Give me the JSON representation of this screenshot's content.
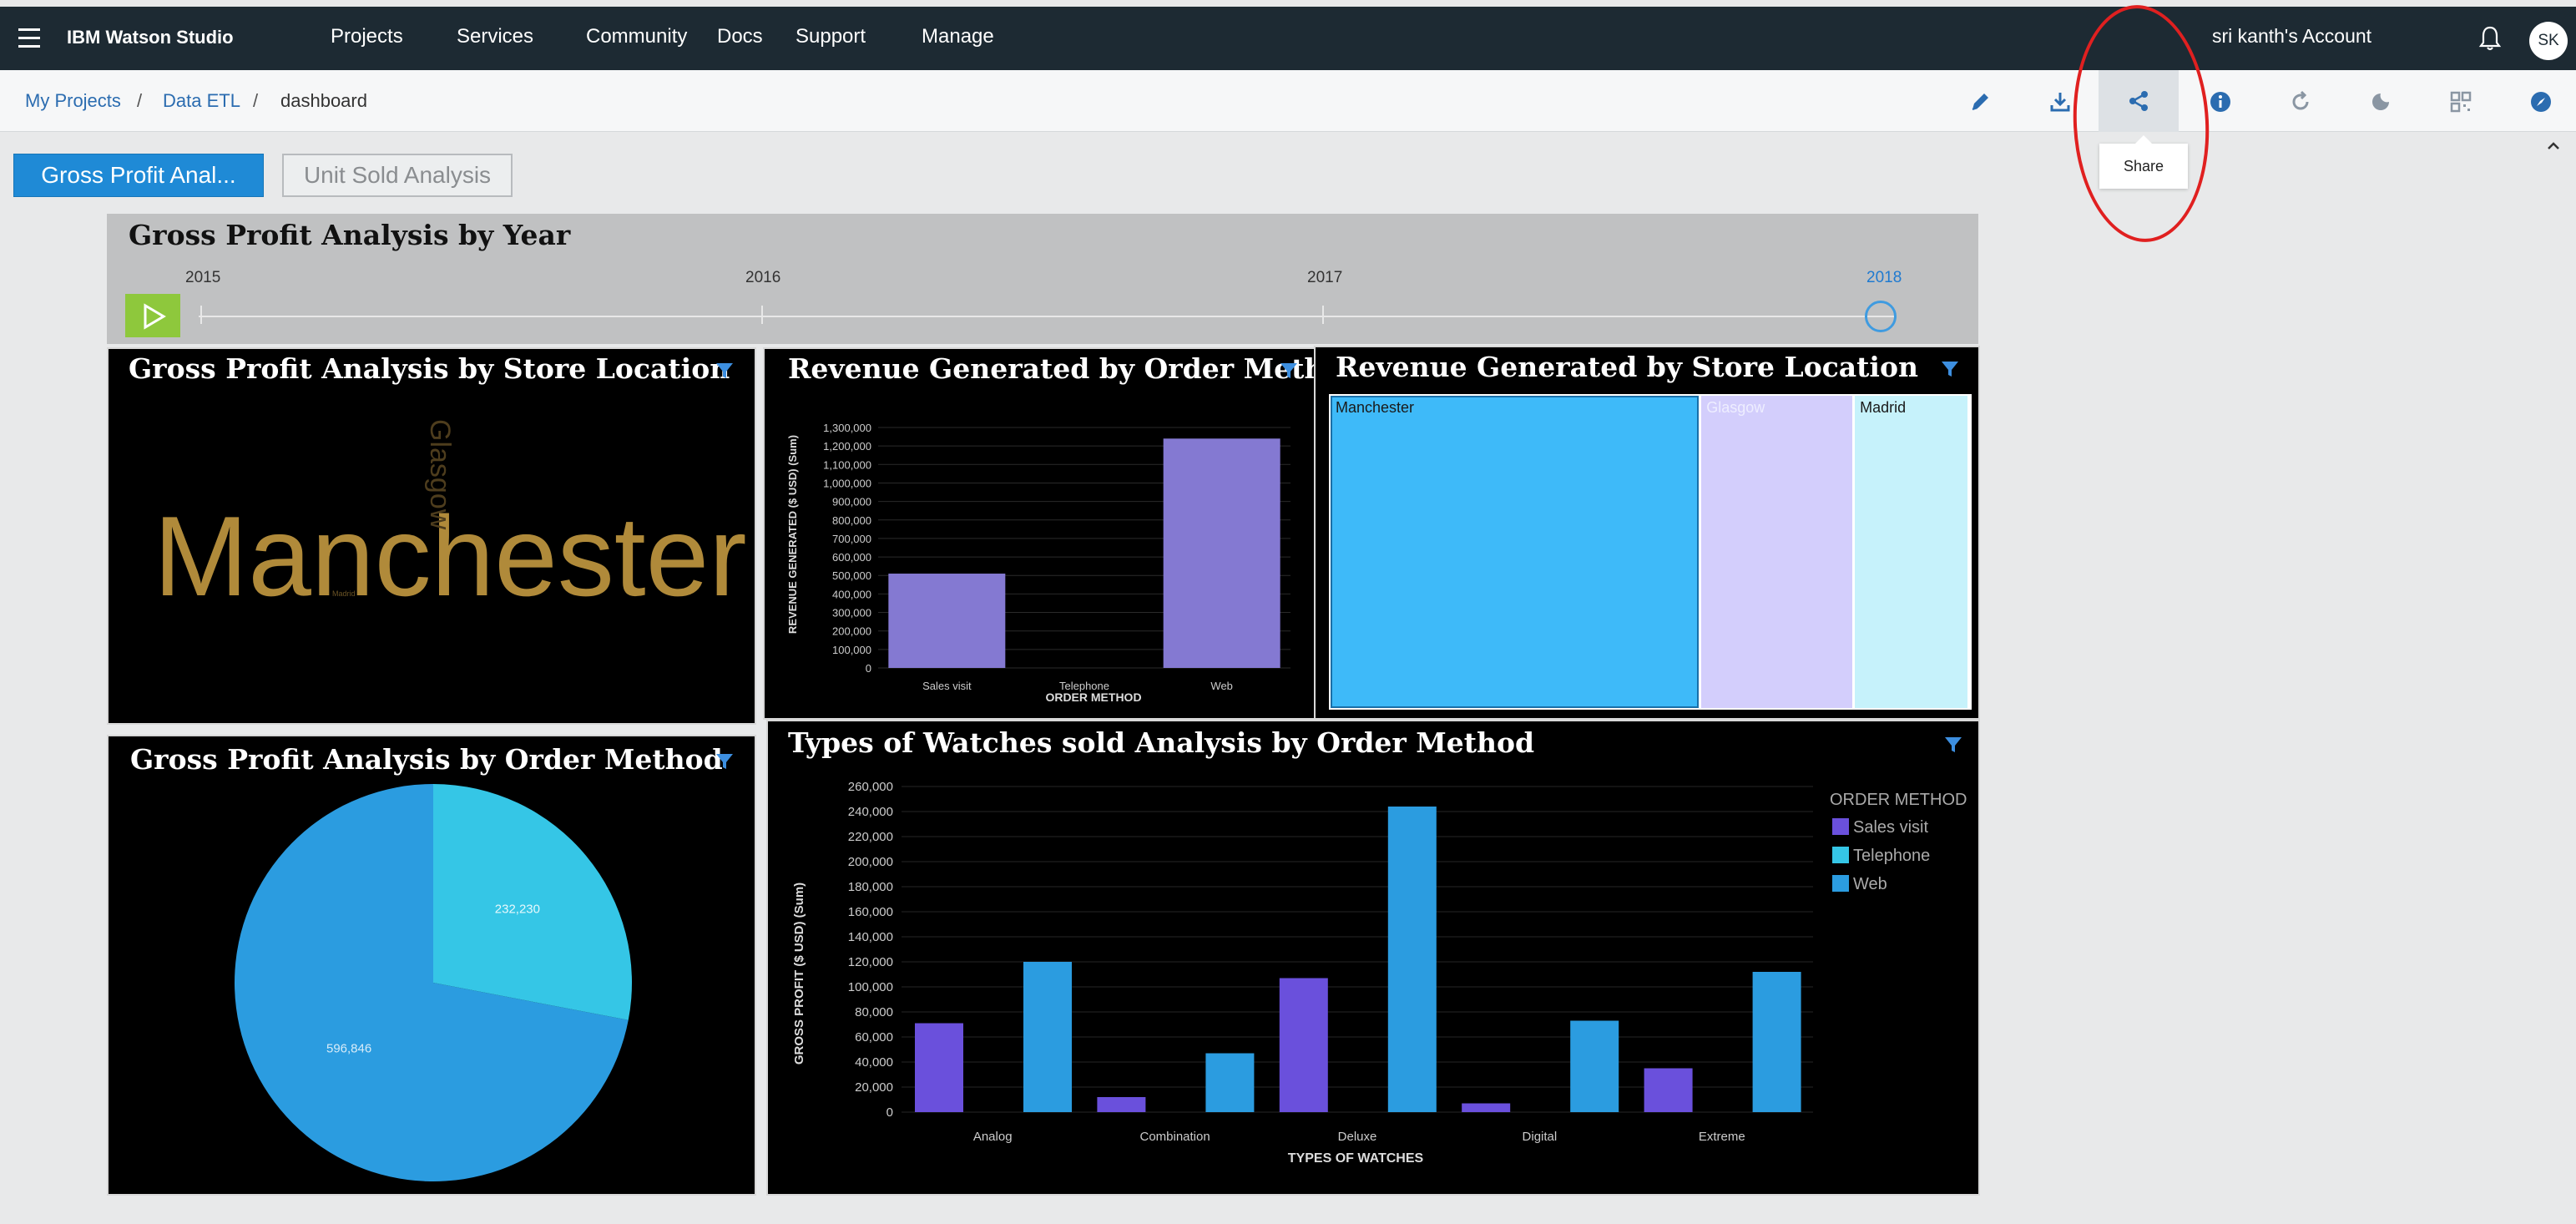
{
  "nav": {
    "brand": "IBM Watson Studio",
    "items": [
      "Projects",
      "Services",
      "Community",
      "Docs",
      "Support",
      "Manage"
    ],
    "account": "sri kanth's Account",
    "avatar_initials": "SK"
  },
  "breadcrumb": {
    "items": [
      "My Projects",
      "Data ETL",
      "dashboard"
    ],
    "separator": "/"
  },
  "toolbar": {
    "icons": [
      "edit-icon",
      "download-icon",
      "share-icon",
      "info-icon",
      "refresh-icon",
      "theme-icon",
      "layout-icon",
      "explore-icon"
    ],
    "tooltip": "Share"
  },
  "tabs": {
    "active": "Gross Profit Anal...",
    "inactive": "Unit Sold Analysis"
  },
  "year_slider": {
    "title": "Gross Profit Analysis by Year",
    "years": [
      "2015",
      "2016",
      "2017",
      "2018"
    ],
    "selected": "2018"
  },
  "panels": {
    "store_location": {
      "title": "Gross Profit Analysis by Store Location"
    },
    "revenue_order": {
      "title": "Revenue Generated by Order Method"
    },
    "revenue_store": {
      "title": "Revenue Generated by Store Location"
    },
    "profit_order": {
      "title": "Gross Profit Analysis by Order Method"
    },
    "watches": {
      "title": "Types of Watches sold Analysis by Order Method"
    }
  },
  "colors": {
    "accent": "#1f8ad6",
    "nav_bg": "#1d2a33",
    "sales_visit": "#6a50dc",
    "telephone": "#35c6e6",
    "web": "#2b9ce0",
    "treemap_manchester": "#3ebaf9",
    "treemap_glasgow": "#d3cefc",
    "treemap_madrid": "#c6f2fb",
    "bar_purple": "#8479d2"
  },
  "chart_data": [
    {
      "type": "wordcloud",
      "title": "Gross Profit Analysis by Store Location",
      "words": [
        "Manchester",
        "Glasgow",
        "Madrid"
      ]
    },
    {
      "type": "bar",
      "title": "Revenue Generated by Order Method",
      "categories": [
        "Sales visit",
        "Telephone",
        "Web"
      ],
      "values": [
        510000,
        0,
        1240000
      ],
      "xlabel": "ORDER METHOD",
      "ylabel": "REVENUE GENERATED ($ USD) (Sum)",
      "ylim": [
        0,
        1300000
      ],
      "yticks": [
        "1,300,000",
        "1,200,000",
        "1,100,000",
        "1,000,000",
        "900,000",
        "800,000",
        "700,000",
        "600,000",
        "500,000",
        "400,000",
        "300,000",
        "200,000",
        "100,000",
        "0"
      ]
    },
    {
      "type": "treemap",
      "title": "Revenue Generated by Store Location",
      "labels": [
        "Manchester",
        "Glasgow",
        "Madrid"
      ],
      "values": [
        58,
        24,
        18
      ]
    },
    {
      "type": "pie",
      "title": "Gross Profit Analysis by Order Method",
      "values": [
        596846,
        232230
      ],
      "value_labels": [
        "596,846",
        "232,230"
      ]
    },
    {
      "type": "bar",
      "title": "Types of Watches sold Analysis by Order Method",
      "categories": [
        "Analog",
        "Combination",
        "Deluxe",
        "Digital",
        "Extreme"
      ],
      "series": [
        {
          "name": "Sales visit",
          "values": [
            71000,
            12000,
            107000,
            7000,
            35000
          ]
        },
        {
          "name": "Web",
          "values": [
            120000,
            47000,
            244000,
            73000,
            112000
          ]
        }
      ],
      "legend_title": "ORDER METHOD",
      "legend_entries": [
        "Sales visit",
        "Telephone",
        "Web"
      ],
      "xlabel": "TYPES OF WATCHES",
      "ylabel": "GROSS PROFIT ($ USD) (Sum)",
      "ylim": [
        0,
        260000
      ],
      "yticks": [
        "260,000",
        "240,000",
        "220,000",
        "200,000",
        "180,000",
        "160,000",
        "140,000",
        "120,000",
        "100,000",
        "80,000",
        "60,000",
        "40,000",
        "20,000",
        "0"
      ]
    }
  ]
}
